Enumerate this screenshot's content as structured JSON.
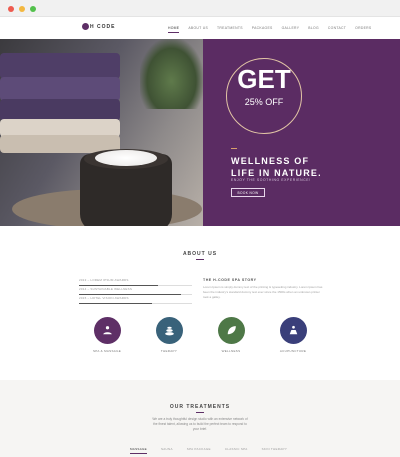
{
  "brand": {
    "logo_text": "H CODE",
    "accent": "#5e2f66"
  },
  "nav": {
    "items": [
      {
        "label": "HOME",
        "active": true
      },
      {
        "label": "ABOUT US",
        "active": false
      },
      {
        "label": "TREATMENTS",
        "active": false
      },
      {
        "label": "PACKAGES",
        "active": false
      },
      {
        "label": "GALLERY",
        "active": false
      },
      {
        "label": "BLOG",
        "active": false
      },
      {
        "label": "CONTACT",
        "active": false
      },
      {
        "label": "ORDERS",
        "active": false
      }
    ]
  },
  "hero": {
    "badge_big": "GET",
    "badge_small": "25% OFF",
    "title_line1": "WELLNESS OF",
    "title_line2": "LIFE IN NATURE.",
    "subtitle": "ENJOY THE SOOTHING EXPERIENCE!",
    "button": "BOOK NOW"
  },
  "about": {
    "title": "ABOUT US",
    "skills": [
      {
        "label": "2013 – LOREM IPSUM AWARDS",
        "level": 0.7
      },
      {
        "label": "2014 – SUSTAINABLE WELLNESS",
        "level": 0.9
      },
      {
        "label": "2015 – HOTEL VISION AWARDS",
        "level": 0.65
      }
    ],
    "heading": "THE H-CODE SPA STORY",
    "body": "Lorem Ipsum is simply dummy text of the printing & typesetting industry. Lorem Ipsum has been the industry's standard dummy text ever since the 1500s when an unknown printer took a galley."
  },
  "services": [
    {
      "label": "SPA & MASSAGE",
      "icon": "massage-icon",
      "color": "#5e2f66"
    },
    {
      "label": "THERAPY",
      "icon": "stones-icon",
      "color": "#39627a"
    },
    {
      "label": "WELLNESS",
      "icon": "leaf-icon",
      "color": "#4e7847"
    },
    {
      "label": "ACUPUNCTURE",
      "icon": "lotus-icon",
      "color": "#3a3f7a"
    }
  ],
  "treatments": {
    "title": "OUR TREATMENTS",
    "body": "We are a truly thoughtful design studio with an extensive network of the finest talent, allowing us to build the perfect team to respond to your brief.",
    "tabs": [
      {
        "label": "MASSAGE",
        "active": true
      },
      {
        "label": "SAUNA",
        "active": false
      },
      {
        "label": "SPA PACKAGE",
        "active": false
      },
      {
        "label": "CLASSIC SPA",
        "active": false
      },
      {
        "label": "SKIN THERAPY",
        "active": false
      }
    ]
  }
}
